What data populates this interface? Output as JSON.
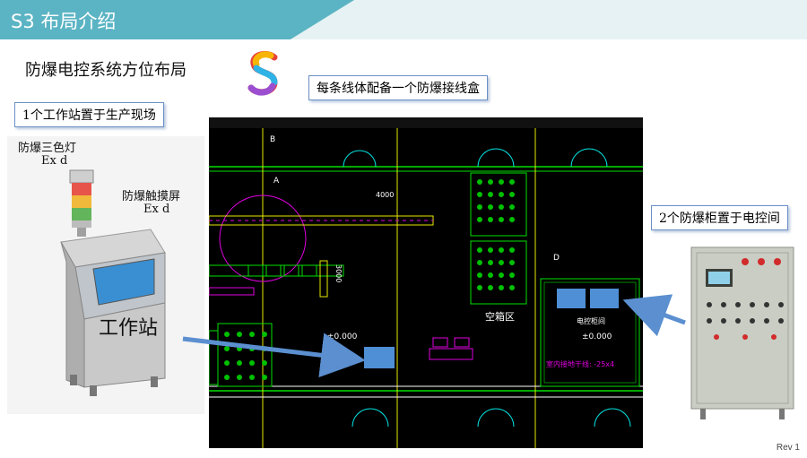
{
  "header": {
    "title": "S3 布局介绍"
  },
  "subtitle": "防爆电控系统方位布局",
  "callouts": {
    "junction_box": "每条线体配备一个防爆接线盒",
    "workstation_site": "1个工作站置于生产现场",
    "cabinets_room": "2个防爆柜置于电控间"
  },
  "labels": {
    "tri_light": "防爆三色灯",
    "tri_light_ex": "Ex  d",
    "touch_screen": "防爆触摸屏",
    "touch_screen_ex": "Ex  d",
    "workstation": "工作站"
  },
  "plan": {
    "empty_box_area": "空箱区",
    "control_room": "电控柜间",
    "elevation_1": "±0.000",
    "elevation_2": "±0.000",
    "dimension": "4000",
    "dimension_v": "3000",
    "grid_a": "A",
    "grid_b": "B",
    "grid_d": "D",
    "ground_note": "室内接地干线: -25x4"
  },
  "footer": {
    "rev": "Rev 1"
  },
  "colors": {
    "accent": "#5bb4c4",
    "header_band": "#e6f2f3",
    "marker_blue": "#4f8fd6",
    "cad_green": "#00e000",
    "cad_yellow": "#e8e800"
  }
}
